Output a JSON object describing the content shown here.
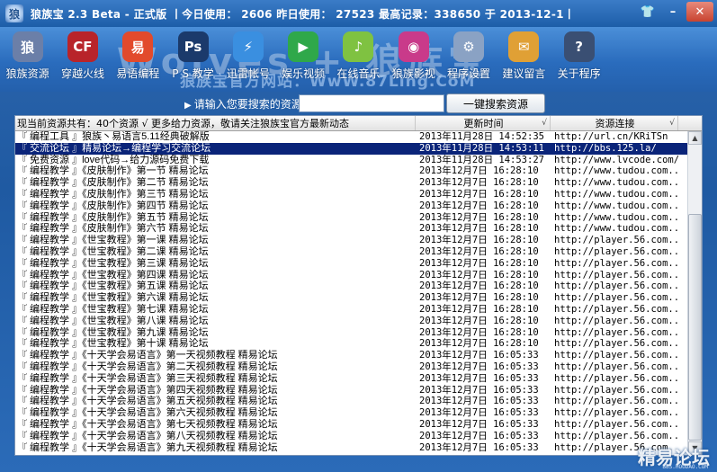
{
  "window": {
    "title": "狼族宝    2.3 Beta - 正式版    丨今日使用：  2606   昨日使用：  27523   最高记录：338650   于   2013-12-1丨"
  },
  "banner": {
    "watermark": "Wolves + 狼族宝",
    "sub_watermark": "狼族宝官方网站：WwW.87Ling.CoM"
  },
  "toolbar": [
    {
      "label": "狼族资源",
      "icon": "wolf-icon"
    },
    {
      "label": "穿越火线",
      "icon": "crossfire-icon"
    },
    {
      "label": "易语编程",
      "icon": "easy-language-icon"
    },
    {
      "label": "P S 教学",
      "icon": "photoshop-icon"
    },
    {
      "label": "迅雷帐号",
      "icon": "thunder-icon"
    },
    {
      "label": "娱乐视频",
      "icon": "video-icon"
    },
    {
      "label": "在线音乐",
      "icon": "music-icon"
    },
    {
      "label": "狼族影视",
      "icon": "movie-icon"
    },
    {
      "label": "程序设置",
      "icon": "settings-icon"
    },
    {
      "label": "建议留言",
      "icon": "message-icon"
    },
    {
      "label": "关于程序",
      "icon": "about-icon"
    }
  ],
  "search": {
    "label": "请输入您要搜索的资源：",
    "value": "",
    "button": "一键搜索资源"
  },
  "list": {
    "columns": [
      "现当前资源共有：40个资源  √  更多给力资源，敬请关注狼族宝官方最新动态",
      "更新时间",
      "资源连接"
    ],
    "rows": [
      {
        "name": "『 编程工具 』狼族丶易语言5.11经典破解版",
        "time": "2013年11月28日 14:52:35",
        "link": "http://url.cn/KRiTSn"
      },
      {
        "name": "『 交流论坛 』精易论坛→编程学习交流论坛",
        "time": "2013年11月28日 14:53:11",
        "link": "http://bbs.125.la/"
      },
      {
        "name": "『 免费资源 』love代码→给力源码免费下载",
        "time": "2013年11月28日 14:53:27",
        "link": "http://www.lvcode.com/"
      },
      {
        "name": "『 编程教学 』《皮肤制作》第一节 精易论坛",
        "time": "2013年12月7日  16:28:10",
        "link": "http://www.tudou.com..."
      },
      {
        "name": "『 编程教学 』《皮肤制作》第二节 精易论坛",
        "time": "2013年12月7日  16:28:10",
        "link": "http://www.tudou.com..."
      },
      {
        "name": "『 编程教学 』《皮肤制作》第三节 精易论坛",
        "time": "2013年12月7日  16:28:10",
        "link": "http://www.tudou.com..."
      },
      {
        "name": "『 编程教学 』《皮肤制作》第四节 精易论坛",
        "time": "2013年12月7日  16:28:10",
        "link": "http://www.tudou.com..."
      },
      {
        "name": "『 编程教学 』《皮肤制作》第五节 精易论坛",
        "time": "2013年12月7日  16:28:10",
        "link": "http://www.tudou.com..."
      },
      {
        "name": "『 编程教学 』《皮肤制作》第六节 精易论坛",
        "time": "2013年12月7日  16:28:10",
        "link": "http://www.tudou.com..."
      },
      {
        "name": "『 编程教学 』《世宝教程》第一课 精易论坛",
        "time": "2013年12月7日  16:28:10",
        "link": "http://player.56.com..."
      },
      {
        "name": "『 编程教学 』《世宝教程》第二课 精易论坛",
        "time": "2013年12月7日  16:28:10",
        "link": "http://player.56.com..."
      },
      {
        "name": "『 编程教学 』《世宝教程》第三课 精易论坛",
        "time": "2013年12月7日  16:28:10",
        "link": "http://player.56.com..."
      },
      {
        "name": "『 编程教学 』《世宝教程》第四课 精易论坛",
        "time": "2013年12月7日  16:28:10",
        "link": "http://player.56.com..."
      },
      {
        "name": "『 编程教学 』《世宝教程》第五课 精易论坛",
        "time": "2013年12月7日  16:28:10",
        "link": "http://player.56.com..."
      },
      {
        "name": "『 编程教学 』《世宝教程》第六课 精易论坛",
        "time": "2013年12月7日  16:28:10",
        "link": "http://player.56.com..."
      },
      {
        "name": "『 编程教学 』《世宝教程》第七课 精易论坛",
        "time": "2013年12月7日  16:28:10",
        "link": "http://player.56.com..."
      },
      {
        "name": "『 编程教学 』《世宝教程》第八课 精易论坛",
        "time": "2013年12月7日  16:28:10",
        "link": "http://player.56.com..."
      },
      {
        "name": "『 编程教学 』《世宝教程》第九课 精易论坛",
        "time": "2013年12月7日  16:28:10",
        "link": "http://player.56.com..."
      },
      {
        "name": "『 编程教学 』《世宝教程》第十课 精易论坛",
        "time": "2013年12月7日  16:28:10",
        "link": "http://player.56.com..."
      },
      {
        "name": "『 编程教学 』《十天学会易语言》第一天视频教程 精易论坛",
        "time": "2013年12月7日  16:05:33",
        "link": "http://player.56.com..."
      },
      {
        "name": "『 编程教学 』《十天学会易语言》第二天视频教程 精易论坛",
        "time": "2013年12月7日  16:05:33",
        "link": "http://player.56.com..."
      },
      {
        "name": "『 编程教学 』《十天学会易语言》第三天视频教程 精易论坛",
        "time": "2013年12月7日  16:05:33",
        "link": "http://player.56.com..."
      },
      {
        "name": "『 编程教学 』《十天学会易语言》第四天视频教程 精易论坛",
        "time": "2013年12月7日  16:05:33",
        "link": "http://player.56.com..."
      },
      {
        "name": "『 编程教学 』《十天学会易语言》第五天视频教程 精易论坛",
        "time": "2013年12月7日  16:05:33",
        "link": "http://player.56.com..."
      },
      {
        "name": "『 编程教学 』《十天学会易语言》第六天视频教程 精易论坛",
        "time": "2013年12月7日  16:05:33",
        "link": "http://player.56.com..."
      },
      {
        "name": "『 编程教学 』《十天学会易语言》第七天视频教程 精易论坛",
        "time": "2013年12月7日  16:05:33",
        "link": "http://player.56.com..."
      },
      {
        "name": "『 编程教学 』《十天学会易语言》第八天视频教程 精易论坛",
        "time": "2013年12月7日  16:05:33",
        "link": "http://player.56.com..."
      },
      {
        "name": "『 编程教学 』《十天学会易语言》第九天视频教程 精易论坛",
        "time": "2013年12月7日  16:05:33",
        "link": "http://player.56.com..."
      }
    ]
  },
  "corner": {
    "logo": "精易论坛",
    "sub": "BBS.HOUDAO.COM"
  }
}
